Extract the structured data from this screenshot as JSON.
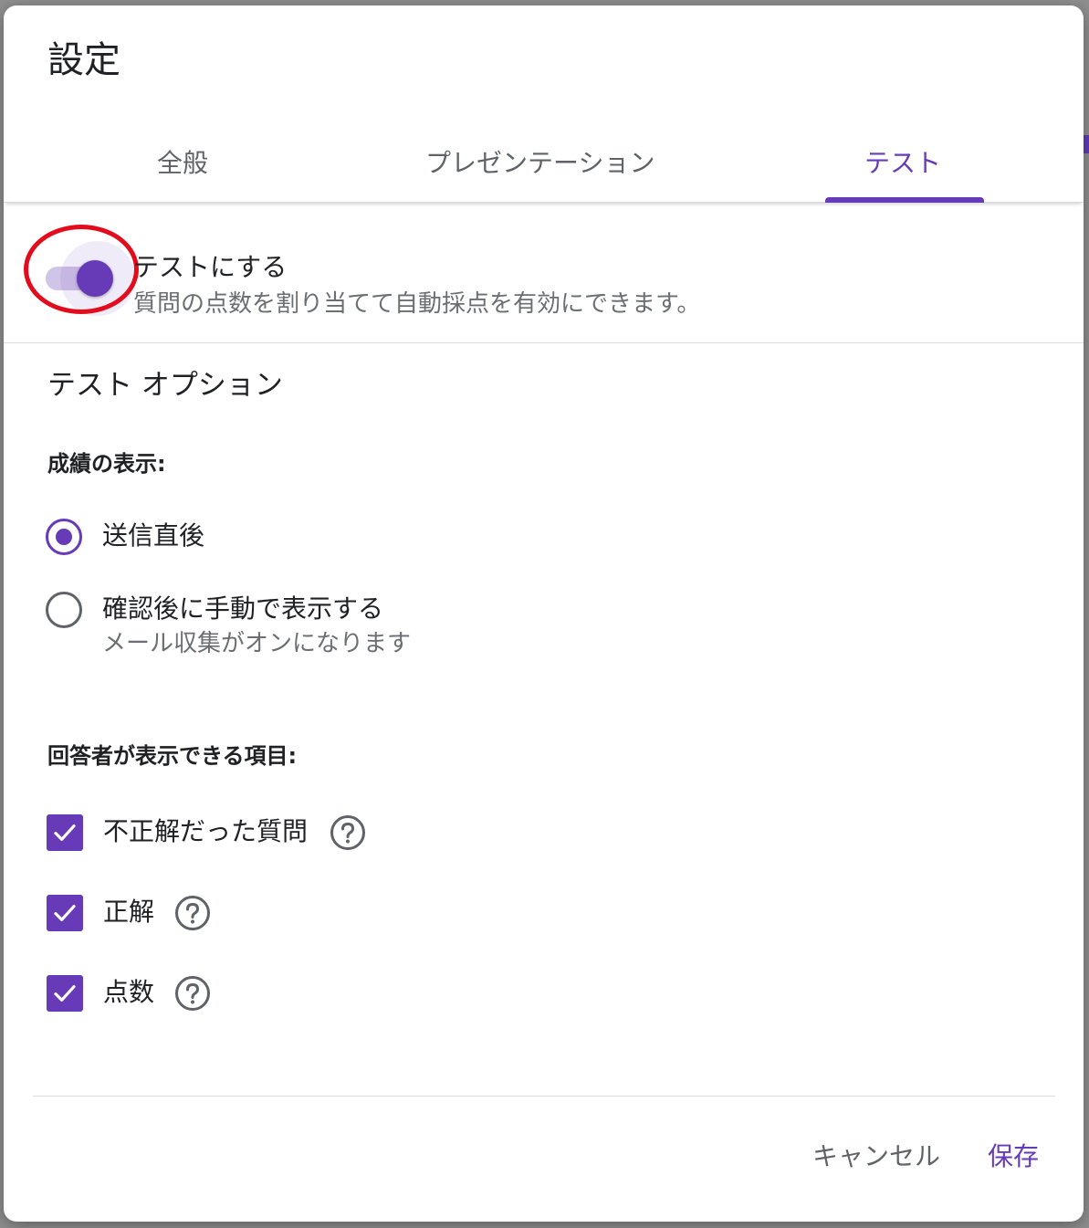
{
  "dialog": {
    "title": "設定"
  },
  "tabs": [
    {
      "label": "全般",
      "active": false
    },
    {
      "label": "プレゼンテーション",
      "active": false
    },
    {
      "label": "テスト",
      "active": true
    }
  ],
  "quiz_toggle": {
    "label": "テストにする",
    "description": "質問の点数を割り当てて自動採点を有効にできます。",
    "enabled": true
  },
  "quiz_options": {
    "title": "テスト オプション",
    "release_grade": {
      "label": "成績の表示:",
      "options": [
        {
          "label": "送信直後",
          "sub": "",
          "selected": true
        },
        {
          "label": "確認後に手動で表示する",
          "sub": "メール収集がオンになります",
          "selected": false
        }
      ]
    },
    "respondent_can_see": {
      "label": "回答者が表示できる項目:",
      "items": [
        {
          "label": "不正解だった質問",
          "checked": true
        },
        {
          "label": "正解",
          "checked": true
        },
        {
          "label": "点数",
          "checked": true
        }
      ]
    }
  },
  "footer": {
    "cancel_label": "キャンセル",
    "save_label": "保存"
  },
  "colors": {
    "accent": "#673ab7",
    "annotation": "#e30c1c"
  }
}
